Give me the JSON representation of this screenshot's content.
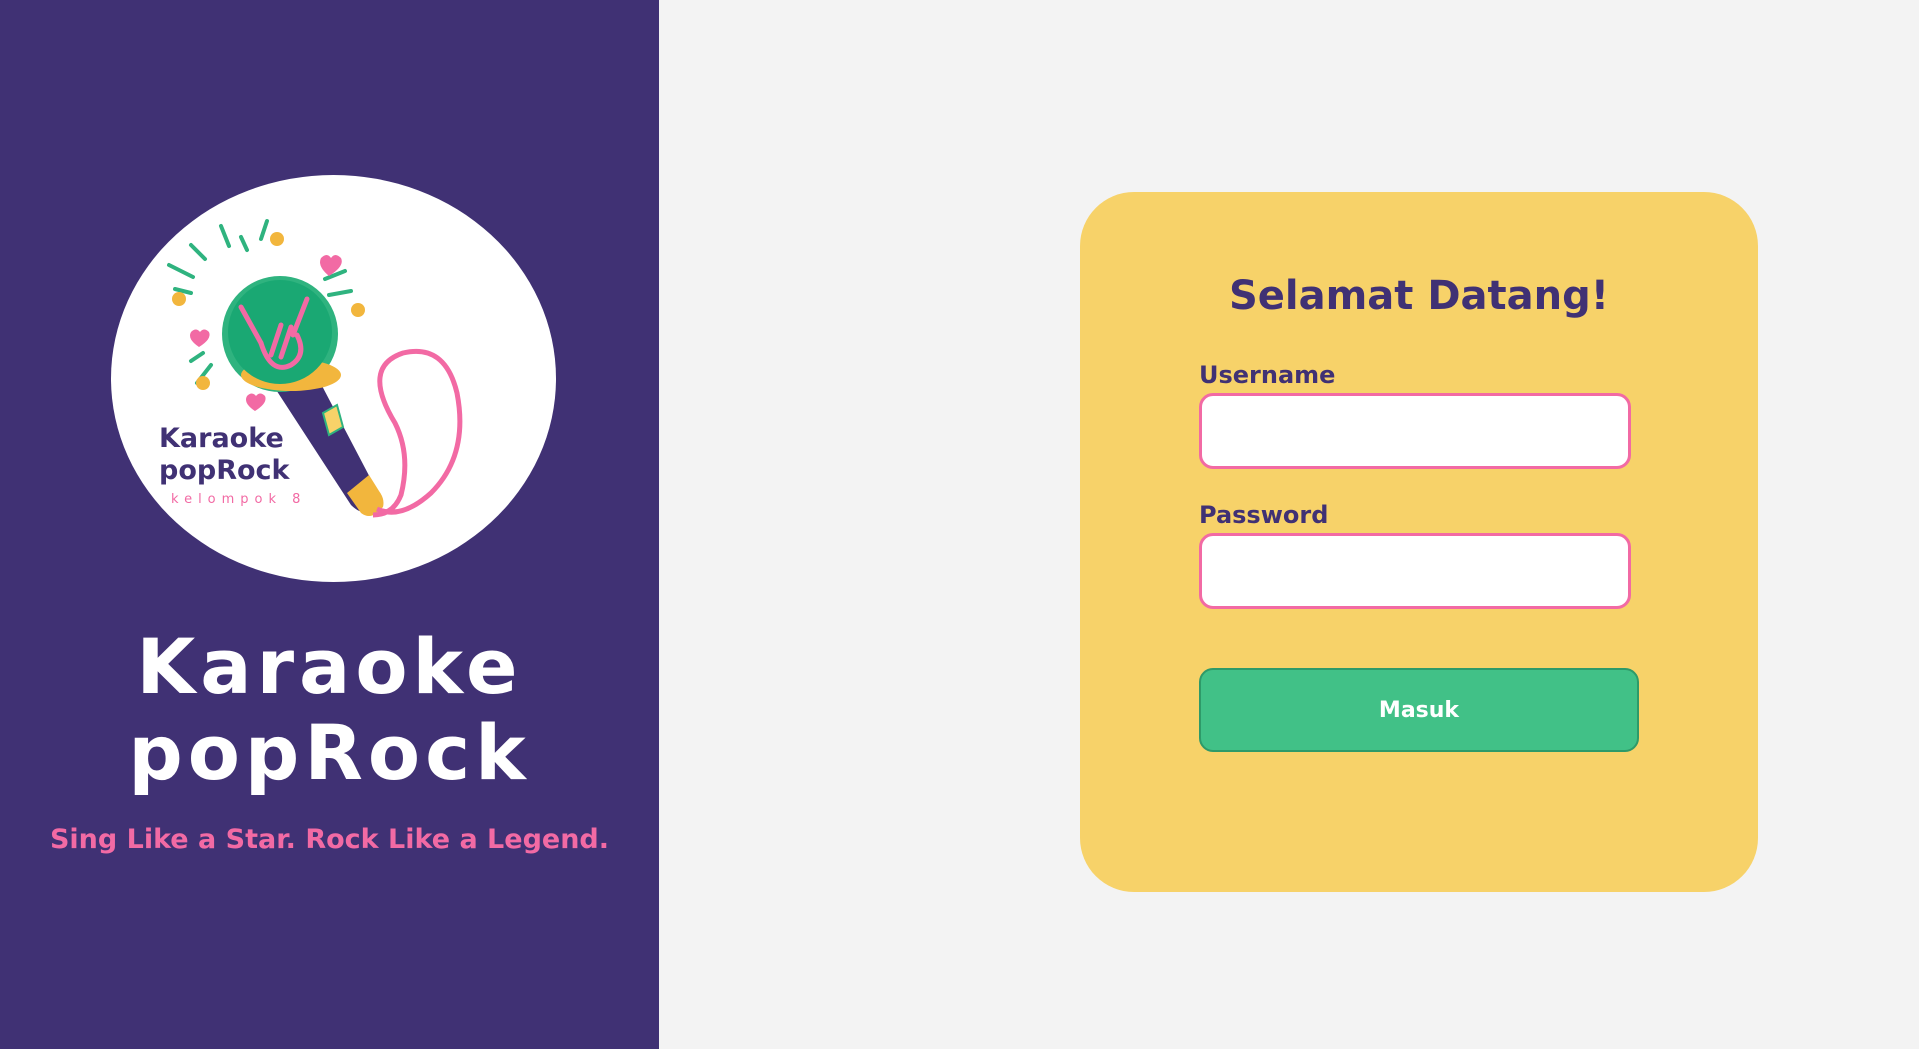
{
  "brand": {
    "logo": {
      "line1": "Karaoke",
      "line2": "popRock",
      "sub": "kelompok 8"
    },
    "title_line1": "Karaoke",
    "title_line2": "popRock",
    "tagline": "Sing Like a Star. Rock Like a Legend."
  },
  "login": {
    "heading": "Selamat Datang!",
    "username_label": "Username",
    "username_value": "",
    "password_label": "Password",
    "password_value": "",
    "submit_label": "Masuk"
  },
  "colors": {
    "sidebar": "#403174",
    "background": "#f3f3f3",
    "card": "#f7d269",
    "accent_pink": "#f26aa4",
    "button_green": "#41c187",
    "text_purple": "#403174"
  },
  "icons": {
    "logo": "microphone-rock-hand-icon"
  }
}
